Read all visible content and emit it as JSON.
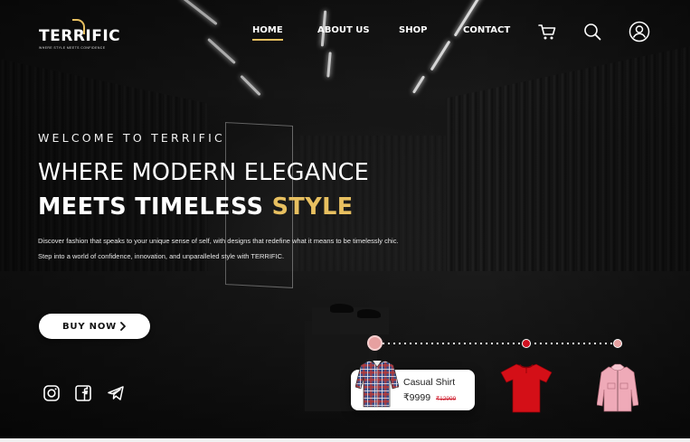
{
  "brand": {
    "name": "TERRIFIC",
    "tagline": "WHERE STYLE MEETS CONFIDENCE",
    "accent_color": "#e8c060"
  },
  "nav": {
    "items": [
      {
        "label": "HOME",
        "active": true
      },
      {
        "label": "ABOUT US",
        "active": false
      },
      {
        "label": "SHOP",
        "active": false
      },
      {
        "label": "CONTACT",
        "active": false
      }
    ],
    "icons": [
      "cart-icon",
      "search-icon",
      "user-account-icon"
    ]
  },
  "hero": {
    "welcome": "WELCOME TO TERRIFIC",
    "headline_line1": "WHERE MODERN ELEGANCE",
    "headline_line2_prefix": "MEETS TIMELESS ",
    "headline_line2_accent": "STYLE",
    "description": "Discover fashion that speaks to your unique sense of self, with designs that redefine what it means to be timelessly chic. Step into a world of confidence, innovation, and unparalleled style with TERRIFIC.",
    "cta_label": "BUY NOW"
  },
  "social": [
    "instagram-icon",
    "facebook-icon",
    "telegram-icon"
  ],
  "products": {
    "featured": {
      "name": "Casual Shirt",
      "price": "₹9999",
      "old_price": "₹12999"
    },
    "items": [
      {
        "icon": "plaid-shirt-image",
        "color": "#e6a0a0"
      },
      {
        "icon": "red-tshirt-image",
        "color": "#d01020"
      },
      {
        "icon": "pink-jacket-image",
        "color": "#e6a0a0"
      }
    ]
  }
}
